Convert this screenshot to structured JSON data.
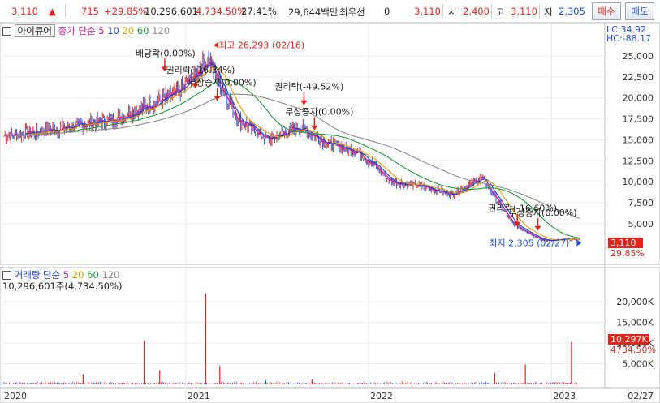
{
  "topbar": {
    "price": "3,110",
    "change": "715",
    "change_pct": "+29.85%",
    "volume": "10,296,601",
    "volume_pct": "4,734.50%",
    "turnover": "27.41%",
    "amount": "29,644백만",
    "pref_label": "최우선",
    "pref_value": "0",
    "pref_price": "3,110",
    "open_label": "시",
    "open_value": "2,400",
    "high_label": "고",
    "high_value": "3,110",
    "low_label": "저",
    "low_value": "2,305",
    "buy_button": "매수",
    "sell_button": "매도"
  },
  "price_panel": {
    "stock_name": "아이큐어",
    "legend_prefix": "종가 단순",
    "ma_periods": [
      "5",
      "10",
      "20",
      "60",
      "120"
    ],
    "lc": "LC:34.92",
    "hc": "HC:-88.17",
    "last_price": "3,110",
    "last_pct": "29.85%"
  },
  "volume_panel": {
    "legend_prefix": "거래량 단순",
    "ma_periods": [
      "5",
      "20",
      "60",
      "120"
    ],
    "info": "10,296,601주(4,734.50%)",
    "last_volume": "10,297K",
    "last_pct": "4734.50%"
  },
  "x_axis": {
    "labels": [
      "2020",
      "2021",
      "2022",
      "2023"
    ],
    "end_date": "02/27"
  },
  "annotations": [
    {
      "text": "최고 26,293 (02/16)",
      "date": "2021-02-16",
      "price": 26293,
      "kind": "high"
    },
    {
      "text": "배당락(0.00%)",
      "date": "2020-11-20",
      "price": 24000,
      "kind": "event"
    },
    {
      "text": "권리락(-16.34%)",
      "date": "2021-01-20",
      "price": 22000,
      "kind": "event"
    },
    {
      "text": "무상증자(0.00%)",
      "date": "2021-03-05",
      "price": 20500,
      "kind": "event"
    },
    {
      "text": "권리락(-49.52%)",
      "date": "2021-08-25",
      "price": 20000,
      "kind": "event"
    },
    {
      "text": "무상증자(0.00%)",
      "date": "2021-09-15",
      "price": 17000,
      "kind": "event"
    },
    {
      "text": "권리락(-16.60%)",
      "date": "2022-10-25",
      "price": 5500,
      "kind": "event"
    },
    {
      "text": "무상증자(0.00%)",
      "date": "2022-12-05",
      "price": 5000,
      "kind": "event"
    },
    {
      "text": "최저 2,305 (02/27)",
      "date": "2023-02-27",
      "price": 2305,
      "kind": "low"
    }
  ],
  "chart_data": [
    {
      "type": "line",
      "title": "",
      "yaxis_side": "right",
      "ylim": [
        1500,
        28000
      ],
      "yticks": [
        "5,000",
        "7,500",
        "10,000",
        "12,500",
        "15,000",
        "17,500",
        "20,000",
        "22,500",
        "25,000"
      ],
      "ytick_values": [
        5000,
        7500,
        10000,
        12500,
        15000,
        17500,
        20000,
        22500,
        25000
      ],
      "x": [
        "2020-01",
        "2020-05",
        "2020-08",
        "2020-10",
        "2020-12",
        "2021-02",
        "2021-04",
        "2021-06",
        "2021-08",
        "2021-10",
        "2021-12",
        "2022-02",
        "2022-04",
        "2022-06",
        "2022-08",
        "2022-10",
        "2022-12",
        "2023-02"
      ],
      "series": [
        {
          "name": "종가",
          "values": [
            15500,
            16500,
            17500,
            19000,
            20500,
            24500,
            17500,
            15000,
            16500,
            14500,
            13500,
            10000,
            9500,
            8500,
            10500,
            5000,
            3000,
            3110
          ]
        }
      ],
      "moving_averages": [
        {
          "period": "5",
          "color": "#c8189c"
        },
        {
          "period": "10",
          "color": "#1f3fd0"
        },
        {
          "period": "20",
          "color": "#e0a000"
        },
        {
          "period": "60",
          "color": "#1f9a3a"
        },
        {
          "period": "120",
          "color": "#8a8a8a"
        }
      ]
    },
    {
      "type": "bar",
      "title": "",
      "yaxis_side": "right",
      "ylim": [
        0,
        22000
      ],
      "yticks": [
        "5,000K",
        "10,000K",
        "15,000K",
        "20,000K"
      ],
      "ytick_values": [
        5000,
        10000,
        15000,
        20000
      ],
      "unit": "K",
      "x": [
        "2020-03",
        "2020-06",
        "2020-10",
        "2020-11",
        "2021-02",
        "2021-03",
        "2021-06",
        "2021-09",
        "2021-12",
        "2022-03",
        "2022-09",
        "2022-11",
        "2023-02"
      ],
      "series": [
        {
          "name": "거래량",
          "values": [
            600,
            2500,
            10500,
            3400,
            22000,
            4500,
            1000,
            1200,
            300,
            800,
            2800,
            4800,
            10297
          ]
        }
      ]
    }
  ]
}
